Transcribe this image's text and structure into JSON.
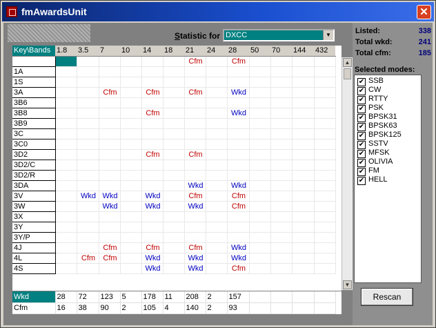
{
  "window": {
    "title": "fmAwardsUnit",
    "close_glyph": "✕"
  },
  "statistic": {
    "label_prefix": "S",
    "label_rest": "tatistic for",
    "value": "DXCC"
  },
  "stats": {
    "listed_label": "Listed:",
    "listed": "338",
    "wkd_label": "Total wkd:",
    "wkd": "241",
    "cfm_label": "Total cfm:",
    "cfm": "185"
  },
  "grid": {
    "corner": "Key\\Bands",
    "bands": [
      "1.8",
      "3.5",
      "7",
      "10",
      "14",
      "18",
      "21",
      "24",
      "28",
      "50",
      "70",
      "144",
      "432"
    ],
    "rows": [
      {
        "key": "",
        "cells": [
          "",
          "",
          "",
          "",
          "",
          "",
          "Cfm",
          "",
          "Cfm",
          "",
          "",
          "",
          ""
        ]
      },
      {
        "key": "1A",
        "cells": [
          "",
          "",
          "",
          "",
          "",
          "",
          "",
          "",
          "",
          "",
          "",
          "",
          ""
        ]
      },
      {
        "key": "1S",
        "cells": [
          "",
          "",
          "",
          "",
          "",
          "",
          "",
          "",
          "",
          "",
          "",
          "",
          ""
        ]
      },
      {
        "key": "3A",
        "cells": [
          "",
          "",
          "Cfm",
          "",
          "Cfm",
          "",
          "Cfm",
          "",
          "Wkd",
          "",
          "",
          "",
          ""
        ]
      },
      {
        "key": "3B6",
        "cells": [
          "",
          "",
          "",
          "",
          "",
          "",
          "",
          "",
          "",
          "",
          "",
          "",
          ""
        ]
      },
      {
        "key": "3B8",
        "cells": [
          "",
          "",
          "",
          "",
          "Cfm",
          "",
          "",
          "",
          "Wkd",
          "",
          "",
          "",
          ""
        ]
      },
      {
        "key": "3B9",
        "cells": [
          "",
          "",
          "",
          "",
          "",
          "",
          "",
          "",
          "",
          "",
          "",
          "",
          ""
        ]
      },
      {
        "key": "3C",
        "cells": [
          "",
          "",
          "",
          "",
          "",
          "",
          "",
          "",
          "",
          "",
          "",
          "",
          ""
        ]
      },
      {
        "key": "3C0",
        "cells": [
          "",
          "",
          "",
          "",
          "",
          "",
          "",
          "",
          "",
          "",
          "",
          "",
          ""
        ]
      },
      {
        "key": "3D2",
        "cells": [
          "",
          "",
          "",
          "",
          "Cfm",
          "",
          "Cfm",
          "",
          "",
          "",
          "",
          "",
          ""
        ]
      },
      {
        "key": "3D2/C",
        "cells": [
          "",
          "",
          "",
          "",
          "",
          "",
          "",
          "",
          "",
          "",
          "",
          "",
          ""
        ]
      },
      {
        "key": "3D2/R",
        "cells": [
          "",
          "",
          "",
          "",
          "",
          "",
          "",
          "",
          "",
          "",
          "",
          "",
          ""
        ]
      },
      {
        "key": "3DA",
        "cells": [
          "",
          "",
          "",
          "",
          "",
          "",
          "Wkd",
          "",
          "Wkd",
          "",
          "",
          "",
          ""
        ]
      },
      {
        "key": "3V",
        "cells": [
          "",
          "Wkd",
          "Wkd",
          "",
          "Wkd",
          "",
          "Cfm",
          "",
          "Cfm",
          "",
          "",
          "",
          ""
        ]
      },
      {
        "key": "3W",
        "cells": [
          "",
          "",
          "Wkd",
          "",
          "Wkd",
          "",
          "Wkd",
          "",
          "Cfm",
          "",
          "",
          "",
          ""
        ]
      },
      {
        "key": "3X",
        "cells": [
          "",
          "",
          "",
          "",
          "",
          "",
          "",
          "",
          "",
          "",
          "",
          "",
          ""
        ]
      },
      {
        "key": "3Y",
        "cells": [
          "",
          "",
          "",
          "",
          "",
          "",
          "",
          "",
          "",
          "",
          "",
          "",
          ""
        ]
      },
      {
        "key": "3Y/P",
        "cells": [
          "",
          "",
          "",
          "",
          "",
          "",
          "",
          "",
          "",
          "",
          "",
          "",
          ""
        ]
      },
      {
        "key": "4J",
        "cells": [
          "",
          "",
          "Cfm",
          "",
          "Cfm",
          "",
          "Cfm",
          "",
          "Wkd",
          "",
          "",
          "",
          ""
        ]
      },
      {
        "key": "4L",
        "cells": [
          "",
          "Cfm",
          "Cfm",
          "",
          "Wkd",
          "",
          "Wkd",
          "",
          "Wkd",
          "",
          "",
          "",
          ""
        ]
      },
      {
        "key": "4S",
        "cells": [
          "",
          "",
          "",
          "",
          "Wkd",
          "",
          "Wkd",
          "",
          "Cfm",
          "",
          "",
          "",
          ""
        ]
      }
    ]
  },
  "summary": {
    "wkd_label": "Wkd",
    "wkd": [
      "28",
      "72",
      "123",
      "5",
      "178",
      "11",
      "208",
      "2",
      "157",
      "",
      "",
      "",
      ""
    ],
    "cfm_label": "Cfm",
    "cfm": [
      "16",
      "38",
      "90",
      "2",
      "105",
      "4",
      "140",
      "2",
      "93",
      "",
      "",
      "",
      ""
    ]
  },
  "modes": {
    "title": "Selected modes:",
    "check_glyph": "✔",
    "items": [
      "SSB",
      "CW",
      "RTTY",
      "PSK",
      "BPSK31",
      "BPSK63",
      "BPSK125",
      "SSTV",
      "MFSK",
      "OLIVIA",
      "FM",
      "HELL"
    ]
  },
  "rescan_label": "Rescan",
  "colors": {
    "title_bar": "#0a246a",
    "teal": "#008080",
    "cfm": "#c00000",
    "wkd": "#0000c0"
  }
}
